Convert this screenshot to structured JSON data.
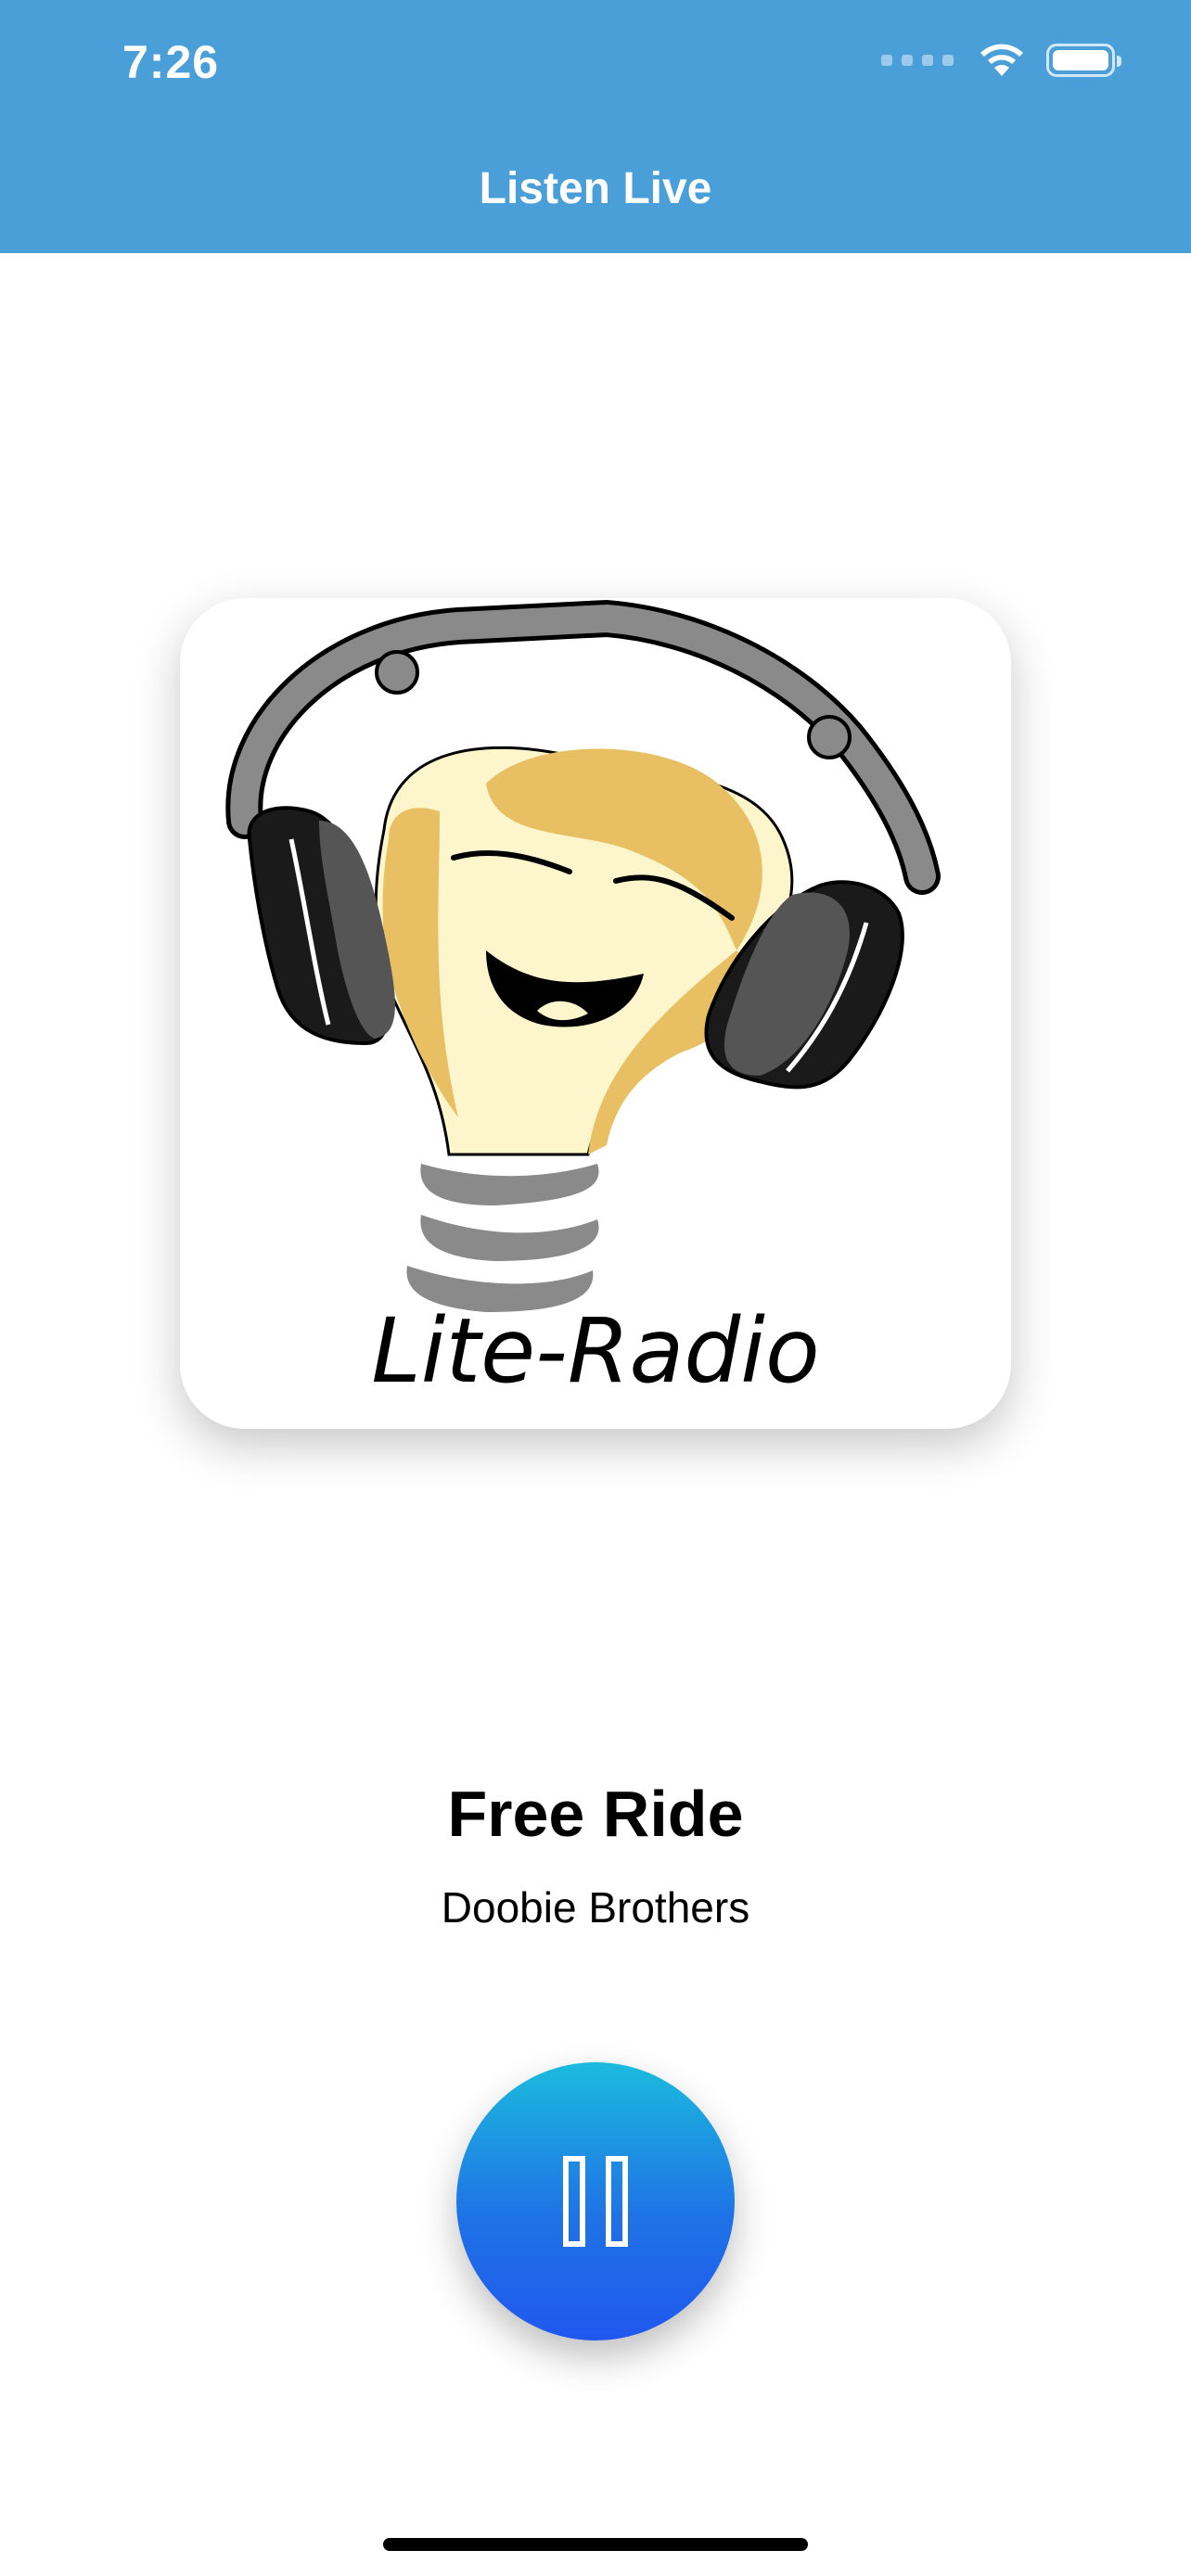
{
  "status_bar": {
    "time": "7:26",
    "wifi_icon": "wifi-icon",
    "battery_icon": "battery-icon"
  },
  "nav": {
    "title": "Listen Live"
  },
  "artwork": {
    "logo_text": "Lite-Radio",
    "description_icon": "lightbulb-headphones-logo"
  },
  "now_playing": {
    "title": "Free Ride",
    "artist": "Doobie Brothers"
  },
  "controls": {
    "state": "playing",
    "button_icon": "pause-icon"
  },
  "colors": {
    "header": "#4a9fd9",
    "button_top": "#1bbbdd",
    "button_bottom": "#2058ee"
  }
}
